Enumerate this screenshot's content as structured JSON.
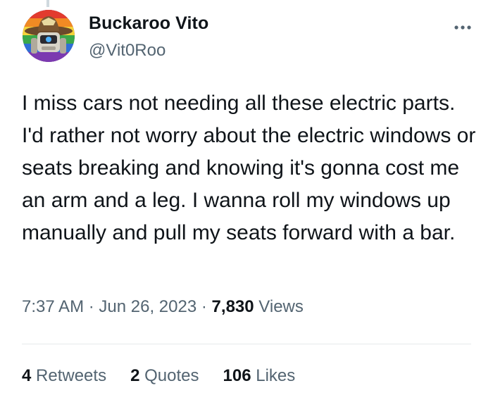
{
  "author": {
    "display_name": "Buckaroo Vito",
    "handle": "@Vit0Roo",
    "avatar_icon": "cowboy-robot-avatar"
  },
  "more_icon": "more-options-icon",
  "tweet": {
    "text": "I miss cars not needing all these electric parts. I'd rather not worry about the electric windows or seats breaking and knowing it's gonna cost me an arm and a leg. I wanna roll my windows up manually and pull my seats forward with a bar."
  },
  "meta": {
    "time": "7:37 AM",
    "separator": "·",
    "date": "Jun 26, 2023",
    "views_count": "7,830",
    "views_label": "Views"
  },
  "stats": {
    "retweets_count": "4",
    "retweets_label": "Retweets",
    "quotes_count": "2",
    "quotes_label": "Quotes",
    "likes_count": "106",
    "likes_label": "Likes"
  },
  "colors": {
    "primary_text": "#0f1419",
    "secondary_text": "#536471",
    "divider": "#e6e9eb"
  }
}
